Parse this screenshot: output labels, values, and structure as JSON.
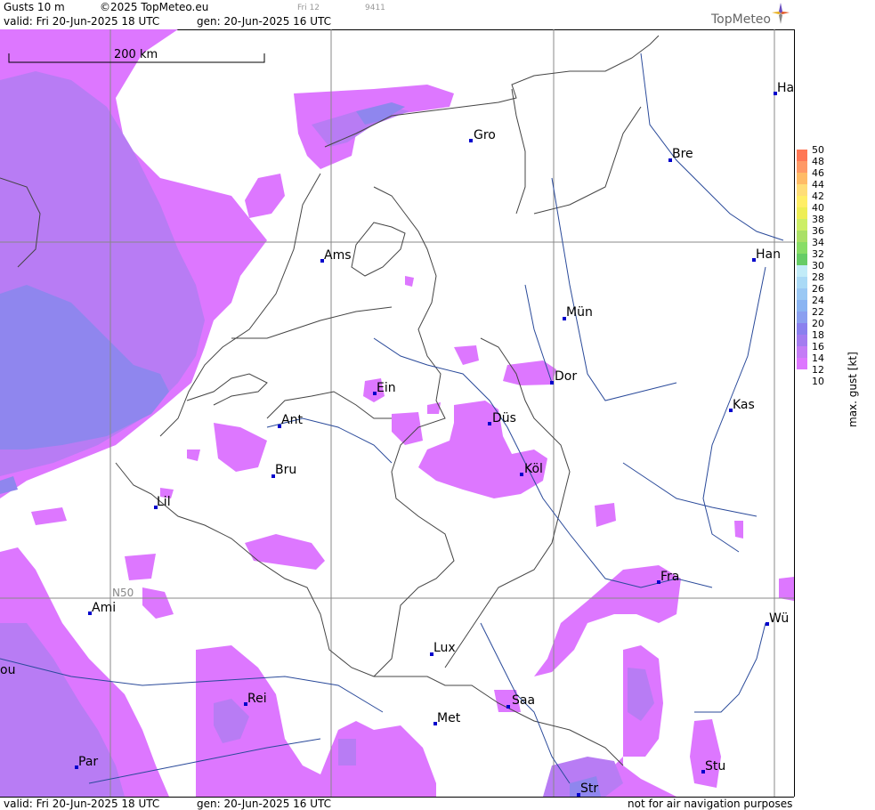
{
  "header": {
    "title": "Gusts 10 m",
    "copyright": "©2025 TopMeteo.eu",
    "valid_label": "valid:  Fri  20-Jun-2025  18 UTC",
    "gen_label": "gen: 20-Jun-2025 16 UTC",
    "faint_1": "Fri 12",
    "faint_2": "9411",
    "brand": "TopMeteo"
  },
  "footer": {
    "valid_label": "valid:  Fri  20-Jun-2025  18 UTC",
    "gen_label": "gen: 20-Jun-2025 16 UTC",
    "disclaimer": "not for air navigation purposes"
  },
  "scale_bar": {
    "label": "200 km"
  },
  "grid_label": "N50",
  "cities": [
    {
      "name": "Gro",
      "label": "Gro"
    },
    {
      "name": "Bre",
      "label": "Bre"
    },
    {
      "name": "Ha",
      "label": "Ha"
    },
    {
      "name": "Ams",
      "label": "Ams"
    },
    {
      "name": "Han",
      "label": "Han"
    },
    {
      "name": "Mün",
      "label": "Mün"
    },
    {
      "name": "Dor",
      "label": "Dor"
    },
    {
      "name": "Ein",
      "label": "Ein"
    },
    {
      "name": "Kas",
      "label": "Kas"
    },
    {
      "name": "Düs",
      "label": "Düs"
    },
    {
      "name": "Ant",
      "label": "Ant"
    },
    {
      "name": "Bru",
      "label": "Bru"
    },
    {
      "name": "Köl",
      "label": "Köl"
    },
    {
      "name": "Lil",
      "label": "Lil"
    },
    {
      "name": "Fra",
      "label": "Fra"
    },
    {
      "name": "Ami",
      "label": "Ami"
    },
    {
      "name": "Wü",
      "label": "Wü"
    },
    {
      "name": "Lux",
      "label": "Lux"
    },
    {
      "name": "Rei",
      "label": "Rei"
    },
    {
      "name": "Saa",
      "label": "Saa"
    },
    {
      "name": "Met",
      "label": "Met"
    },
    {
      "name": "Par",
      "label": "Par"
    },
    {
      "name": "Stu",
      "label": "Stu"
    },
    {
      "name": "Str",
      "label": "Str"
    },
    {
      "name": "ou",
      "label": "ou"
    }
  ],
  "legend": {
    "title": "max. gust [kt]",
    "ticks": [
      "50",
      "48",
      "46",
      "44",
      "42",
      "40",
      "38",
      "36",
      "34",
      "32",
      "30",
      "28",
      "26",
      "24",
      "22",
      "20",
      "18",
      "16",
      "14",
      "12",
      "10"
    ],
    "colors": {
      "12-14": "#dd77ff",
      "14-16": "#c47cf6",
      "16-18": "#a47cf0",
      "18-20": "#8a80ee",
      "20-22": "#8a9ff0",
      "22-24": "#8ab4f2",
      "24-26": "#9ac8f4",
      "26-28": "#aadaf6",
      "28-30": "#c2ecf8",
      "30-32": "#66cc66",
      "32-34": "#88dd66",
      "34-36": "#aae066",
      "36-38": "#ccee66",
      "38-40": "#eeee55",
      "40-42": "#ffee66",
      "42-44": "#ffdd77",
      "44-46": "#ffbb66",
      "46-48": "#ff9966",
      "48-50": "#ff7755"
    }
  },
  "colors": {
    "gust_light": "#dd77ff",
    "gust_mid": "#b87cf4",
    "gust_strong": "#8f86ee",
    "river": "#2a4a9a",
    "border": "#444444",
    "grid": "#888888"
  }
}
